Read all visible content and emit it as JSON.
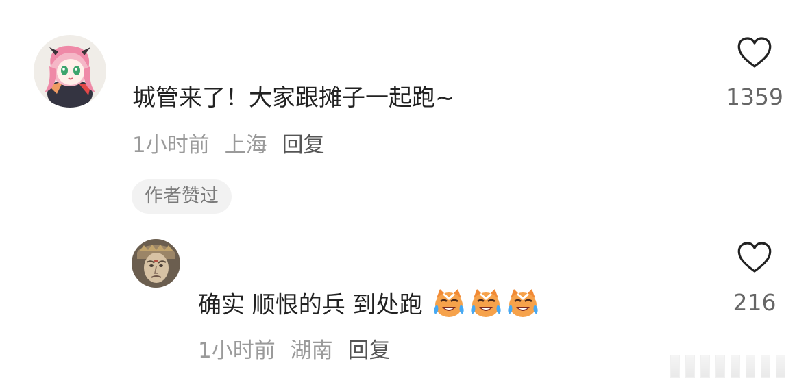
{
  "comments": [
    {
      "text": "城管来了！大家跟摊子一起跑~",
      "time": "1小时前",
      "location": "上海",
      "reply_label": "回复",
      "badge": "作者赞过",
      "likes": "1359",
      "avatar_icon": "anime-girl-avatar"
    },
    {
      "text": "确实 顺恨的兵 到处跑",
      "emoji_icons": [
        "crying-laughing-cat-emoji",
        "crying-laughing-cat-emoji",
        "crying-laughing-cat-emoji"
      ],
      "time": "1小时前",
      "location": "湖南",
      "reply_label": "回复",
      "likes": "216",
      "avatar_icon": "statue-face-avatar"
    }
  ],
  "colors": {
    "text_primary": "#222222",
    "text_secondary": "#9a9a9a",
    "badge_bg": "#f2f2f2",
    "like_count": "#666666"
  }
}
